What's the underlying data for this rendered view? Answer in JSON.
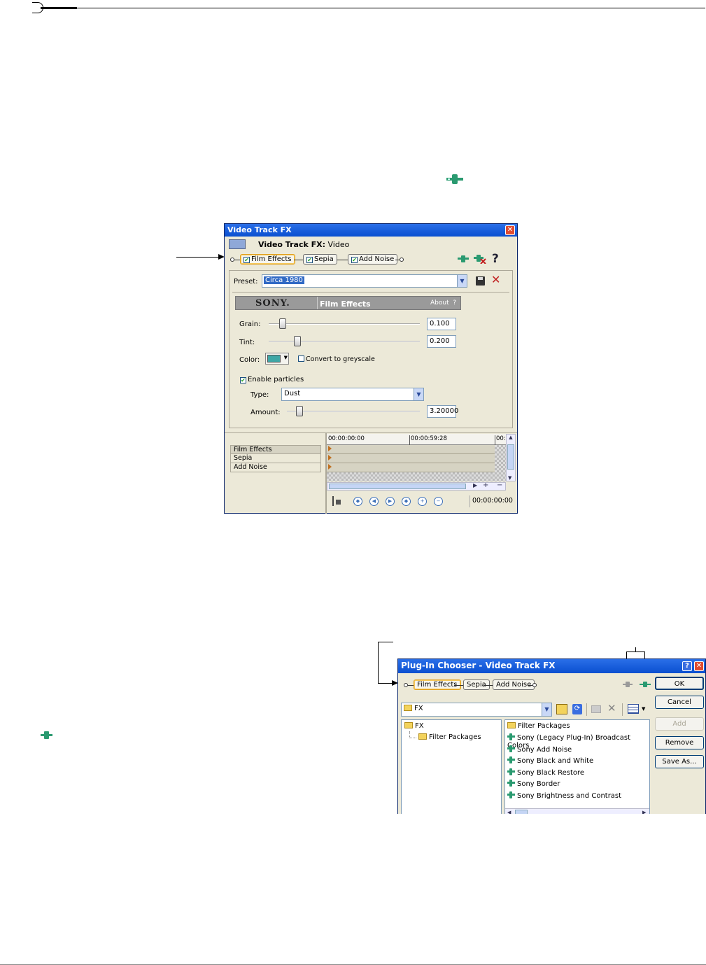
{
  "fx_window": {
    "title": "Video Track FX",
    "header_label": "Video Track FX:",
    "header_value": "Video",
    "chain": [
      {
        "label": "Film Effects",
        "checked": true
      },
      {
        "label": "Sepia",
        "checked": true
      },
      {
        "label": "Add Noise",
        "checked": true
      }
    ],
    "preset_label": "Preset:",
    "preset_value": "Circa 1980",
    "brand": "SONY.",
    "plugin_name": "Film Effects",
    "about": "About",
    "about_q": "?",
    "help_q": "?",
    "grain_label": "Grain:",
    "grain_value": "0.100",
    "grain_level": 0.1,
    "tint_label": "Tint:",
    "tint_value": "0.200",
    "tint_level": 0.2,
    "color_label": "Color:",
    "color_swatch": "#3fa7a6",
    "greyscale_label": "Convert to greyscale",
    "particles_label": "Enable particles",
    "type_label": "Type:",
    "type_value": "Dust",
    "amount_label": "Amount:",
    "amount_value": "3.20000",
    "timeline_list": [
      "Film Effects",
      "Sepia",
      "Add Noise"
    ],
    "time_start": "00:00:00:00",
    "time_mid": "00:00:59:28",
    "time_end_cut": "00:",
    "time_current": "00:00:00:00"
  },
  "chooser": {
    "title": "Plug-In Chooser - Video Track FX",
    "chain": [
      "Film Effects",
      "Sepia",
      "Add Noise"
    ],
    "folder_value": "FX",
    "tree": [
      "FX",
      "Filter Packages"
    ],
    "list": [
      "Filter Packages",
      "Sony (Legacy Plug-In) Broadcast Colors",
      "Sony Add Noise",
      "Sony Black and White",
      "Sony Black Restore",
      "Sony Border",
      "Sony Brightness and Contrast"
    ],
    "buttons": {
      "ok": "OK",
      "cancel": "Cancel",
      "add": "Add",
      "remove": "Remove",
      "save_as": "Save As..."
    }
  }
}
